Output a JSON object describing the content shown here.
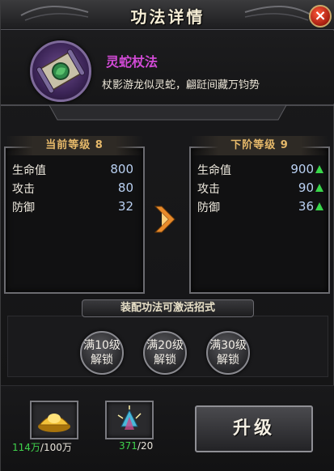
{
  "window": {
    "title": "功法详情",
    "close_label": "×"
  },
  "skill": {
    "name": "灵蛇杖法",
    "description": "杖影游龙似灵蛇，翩跹间藏万钧势",
    "icon": "scroll-icon"
  },
  "current": {
    "header": "当前等级 8",
    "stats": [
      {
        "label": "生命值",
        "value": "800"
      },
      {
        "label": "攻击",
        "value": "80"
      },
      {
        "label": "防御",
        "value": "32"
      }
    ]
  },
  "next": {
    "header": "下阶等级 9",
    "stats": [
      {
        "label": "生命值",
        "value": "900"
      },
      {
        "label": "攻击",
        "value": "90"
      },
      {
        "label": "防御",
        "value": "36"
      }
    ]
  },
  "unlock": {
    "title": "装配功法可激活招式",
    "badges": [
      {
        "line1": "满10级",
        "line2": "解锁"
      },
      {
        "line1": "满20级",
        "line2": "解锁"
      },
      {
        "line1": "满30级",
        "line2": "解锁"
      }
    ]
  },
  "costs": [
    {
      "item": "gold-ingot-icon",
      "have": "114万",
      "need": "/100万"
    },
    {
      "item": "crystal-icon",
      "have": "371",
      "need": "/20"
    }
  ],
  "upgrade_label": "升级",
  "colors": {
    "skill_name": "#d24ad6",
    "sufficient": "#3fd24c",
    "header_gold": "#e6b96a",
    "stat_value": "#b9d0f2"
  }
}
